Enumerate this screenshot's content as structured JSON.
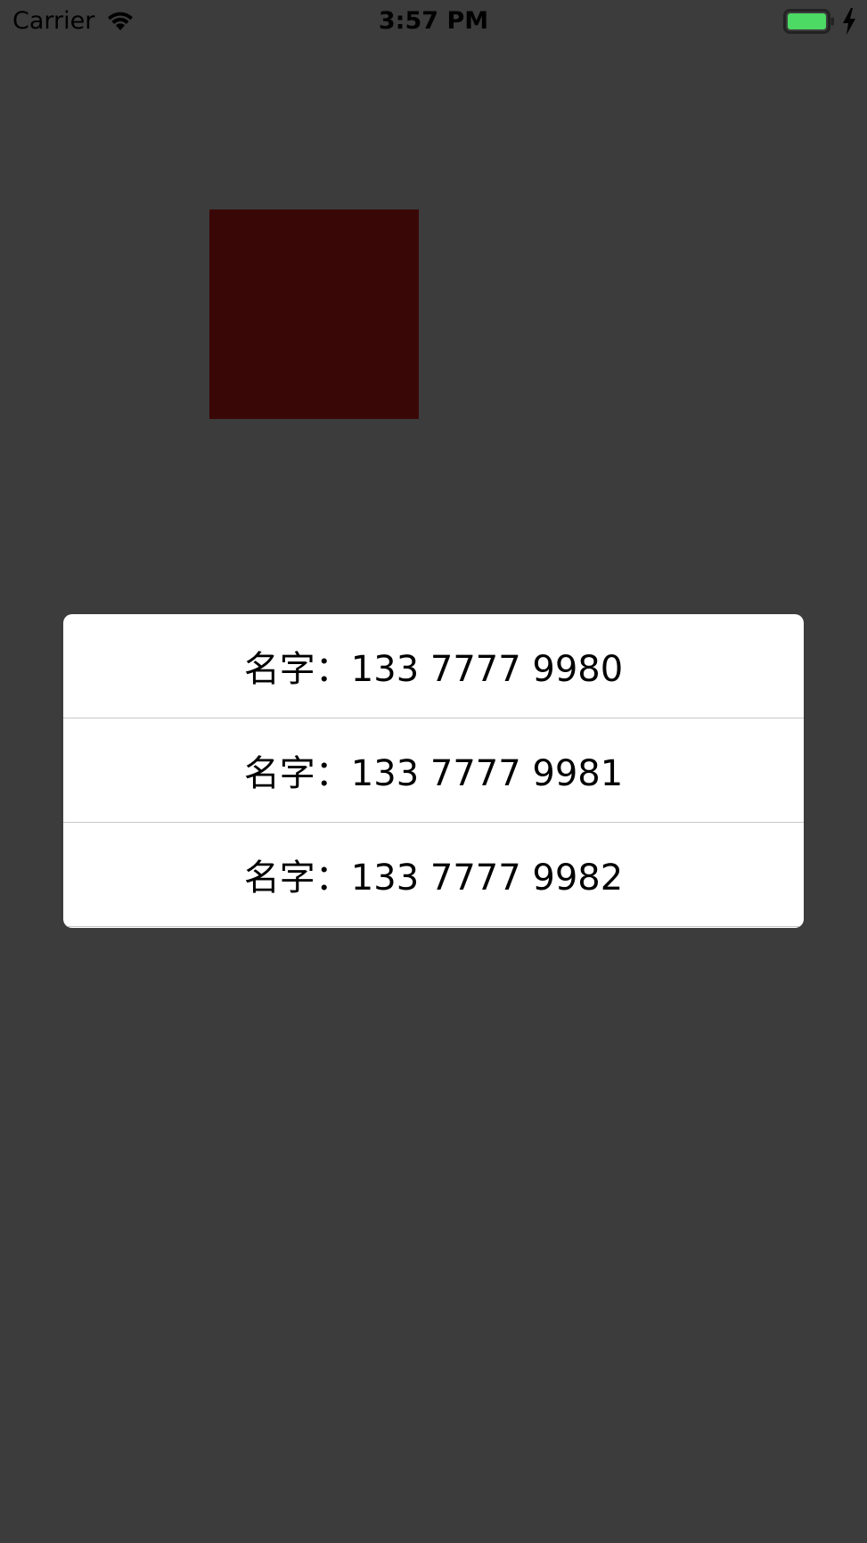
{
  "status_bar": {
    "carrier": "Carrier",
    "time": "3:57 PM",
    "wifi_icon": "wifi-icon",
    "battery_icon": "battery-icon",
    "charging_icon": "charging-bolt-icon",
    "battery_color": "#4cd964"
  },
  "background_color": "#3c3c3c",
  "square": {
    "color": "#3a0707"
  },
  "popup": {
    "items": [
      {
        "label": "名字：133 7777 9980"
      },
      {
        "label": "名字：133 7777 9981"
      },
      {
        "label": "名字：133 7777 9982"
      }
    ]
  }
}
